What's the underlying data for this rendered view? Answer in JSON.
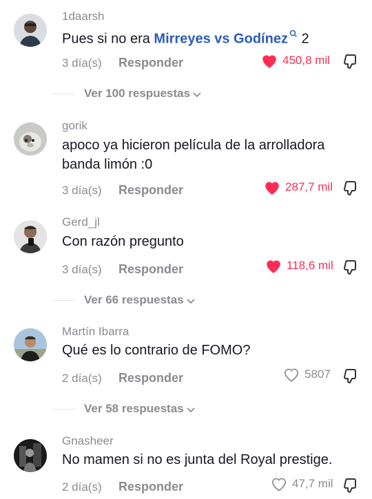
{
  "comments": [
    {
      "username": "1daarsh",
      "text_before": "Pues si no era ",
      "link": "Mirreyes vs Godínez",
      "text_after": " 2",
      "time": "3 día(s)",
      "reply_label": "Responder",
      "likes": "450,8 mil",
      "liked": true,
      "view_replies": "Ver 100 respuestas"
    },
    {
      "username": "gorik",
      "text_line1": "apoco ya hicieron película de la arrolladora",
      "text_line2": "banda limón :0",
      "time": "3 día(s)",
      "reply_label": "Responder",
      "likes": "287,7 mil",
      "liked": true
    },
    {
      "username": "Gerd_jl",
      "text": "Con razón pregunto",
      "time": "3 día(s)",
      "reply_label": "Responder",
      "likes": "118,6 mil",
      "liked": true,
      "view_replies": "Ver 66 respuestas"
    },
    {
      "username": "Martín Ibarra",
      "text": "Qué es lo contrario de FOMO?",
      "time": "2 día(s)",
      "reply_label": "Responder",
      "likes": "5807",
      "liked": false,
      "view_replies": "Ver 58 respuestas"
    },
    {
      "username": "Gnasheer",
      "text": "No mamen si no es junta del Royal prestige.",
      "time": "2 día(s)",
      "reply_label": "Responder",
      "likes": "47,7 mil",
      "liked": false
    }
  ],
  "colors": {
    "like_active": "#fe2c55",
    "muted": "#8a8b91",
    "link": "#2b5db9"
  },
  "icons": {
    "like": "heart-icon",
    "dislike": "dislike-icon",
    "view_more": "chevron-down-icon",
    "link_search": "search-icon"
  }
}
